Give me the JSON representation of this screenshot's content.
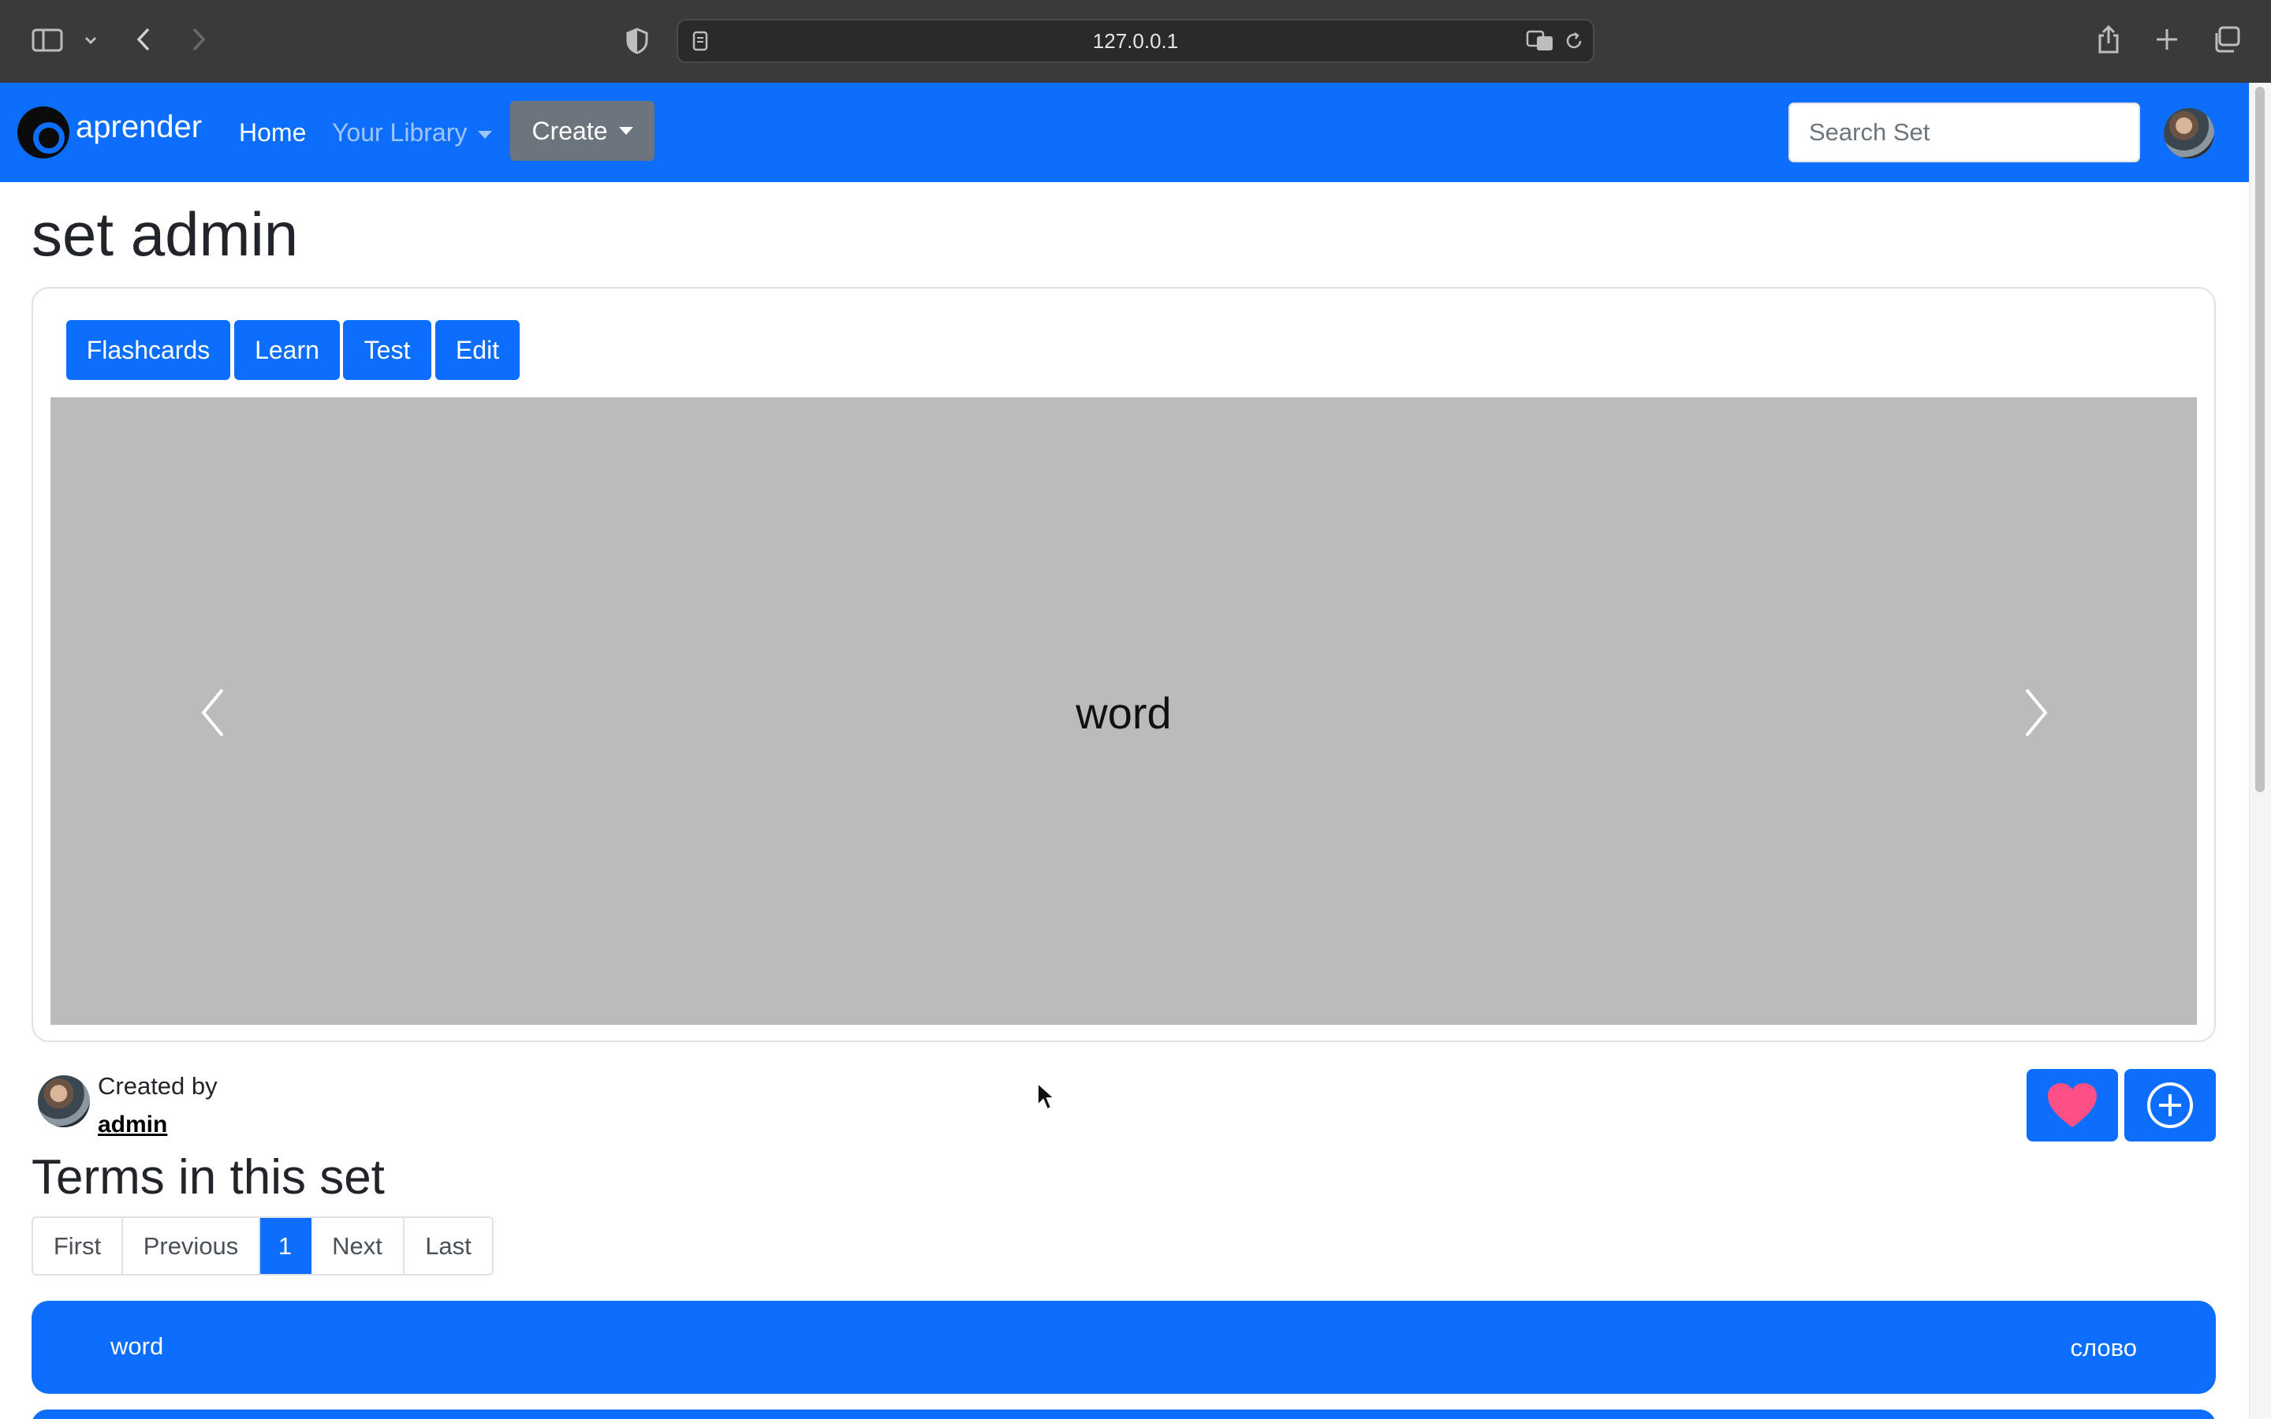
{
  "browser": {
    "url": "127.0.0.1"
  },
  "navbar": {
    "brand": "aprender",
    "home": "Home",
    "library": "Your Library",
    "create": "Create",
    "search_placeholder": "Search Set"
  },
  "page": {
    "title": "set admin",
    "modes": [
      "Flashcards",
      "Learn",
      "Test",
      "Edit"
    ],
    "flashcard_text": "word"
  },
  "creator": {
    "label": "Created by",
    "name": "admin"
  },
  "terms_section": {
    "title": "Terms in this set",
    "pagination": [
      "First",
      "Previous",
      "1",
      "Next",
      "Last"
    ],
    "current_page": "1",
    "terms": [
      {
        "term": "word",
        "definition": "слово"
      }
    ]
  },
  "colors": {
    "primary": "#0d6efd",
    "secondary": "#6c757d",
    "card_bg": "#bbbbbb",
    "heart": "#ff4f87"
  }
}
